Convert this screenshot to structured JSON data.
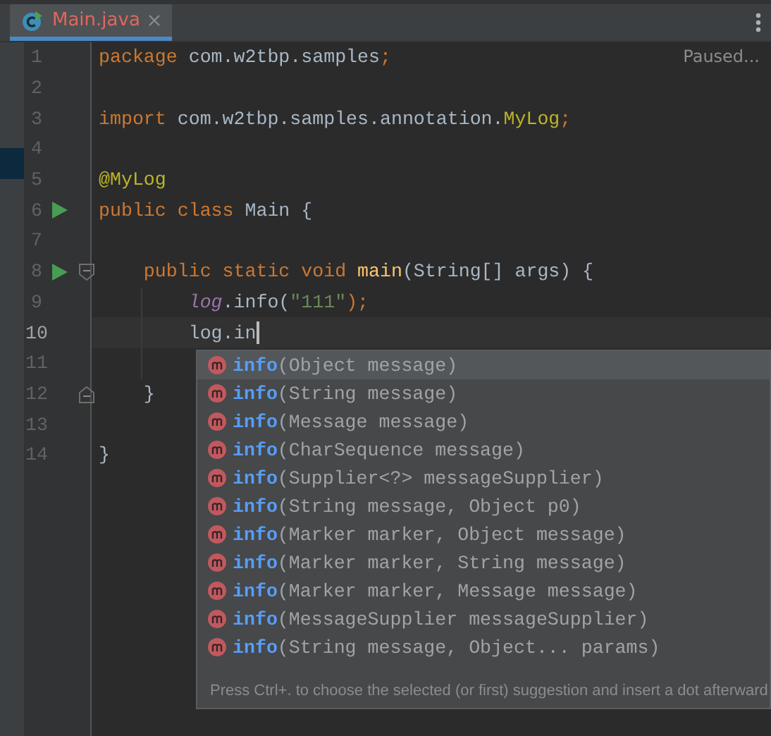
{
  "tabs": [
    {
      "label": "Main.java",
      "selected": true,
      "has_errors": true
    }
  ],
  "editor": {
    "status": "Paused...",
    "lines": [
      {
        "number": "1",
        "tokens": [
          {
            "text": "package ",
            "kind": "keyword"
          },
          {
            "text": "com.w2tbp.samples",
            "kind": "plain"
          },
          {
            "text": ";",
            "kind": "keyword"
          }
        ]
      },
      {
        "number": "2"
      },
      {
        "number": "3",
        "tokens": [
          {
            "text": "import ",
            "kind": "keyword"
          },
          {
            "text": "com.w2tbp.samples.annotation.",
            "kind": "plain"
          },
          {
            "text": "MyLog",
            "kind": "annotation"
          },
          {
            "text": ";",
            "kind": "keyword"
          }
        ]
      },
      {
        "number": "4"
      },
      {
        "number": "5",
        "tokens": [
          {
            "text": "@MyLog",
            "kind": "annotation"
          }
        ]
      },
      {
        "number": "6",
        "run": true,
        "tokens": [
          {
            "text": "public class ",
            "kind": "keyword"
          },
          {
            "text": "Main {",
            "kind": "plain"
          }
        ]
      },
      {
        "number": "7"
      },
      {
        "number": "8",
        "run": true,
        "fold_start": true,
        "tokens": [
          {
            "text": "    public static void ",
            "kind": "keyword"
          },
          {
            "text": "main",
            "kind": "method"
          },
          {
            "text": "(String[] args) {",
            "kind": "plain"
          }
        ]
      },
      {
        "number": "9",
        "tokens": [
          {
            "text": "        log",
            "kind": "field"
          },
          {
            "text": ".info(",
            "kind": "plain"
          },
          {
            "text": "\"111\"",
            "kind": "string"
          },
          {
            "text": ");",
            "kind": "keyword"
          }
        ]
      },
      {
        "number": "10",
        "current": true,
        "tokens": [
          {
            "text": "        log.in",
            "kind": "plain"
          }
        ]
      },
      {
        "number": "11"
      },
      {
        "number": "12",
        "fold_end": true,
        "tokens": [
          {
            "text": "    }",
            "kind": "plain"
          }
        ]
      },
      {
        "number": "13"
      },
      {
        "number": "14",
        "tokens": [
          {
            "text": "}",
            "kind": "plain"
          }
        ]
      }
    ]
  },
  "completion": {
    "items": [
      {
        "name": "info",
        "params": "(Object message)",
        "selected": true
      },
      {
        "name": "info",
        "params": "(String message)",
        "selected": false
      },
      {
        "name": "info",
        "params": "(Message message)",
        "selected": false
      },
      {
        "name": "info",
        "params": "(CharSequence message)",
        "selected": false
      },
      {
        "name": "info",
        "params": "(Supplier<?> messageSupplier)",
        "selected": false
      },
      {
        "name": "info",
        "params": "(String message, Object p0)",
        "selected": false
      },
      {
        "name": "info",
        "params": "(Marker marker, Object message)",
        "selected": false
      },
      {
        "name": "info",
        "params": "(Marker marker, String message)",
        "selected": false
      },
      {
        "name": "info",
        "params": "(Marker marker, Message message)",
        "selected": false
      },
      {
        "name": "info",
        "params": "(MessageSupplier messageSupplier)",
        "selected": false
      },
      {
        "name": "info",
        "params": "(String message, Object... params)",
        "selected": false
      }
    ],
    "hint": "Press Ctrl+. to choose the selected (or first) suggestion and insert a dot afterward"
  }
}
